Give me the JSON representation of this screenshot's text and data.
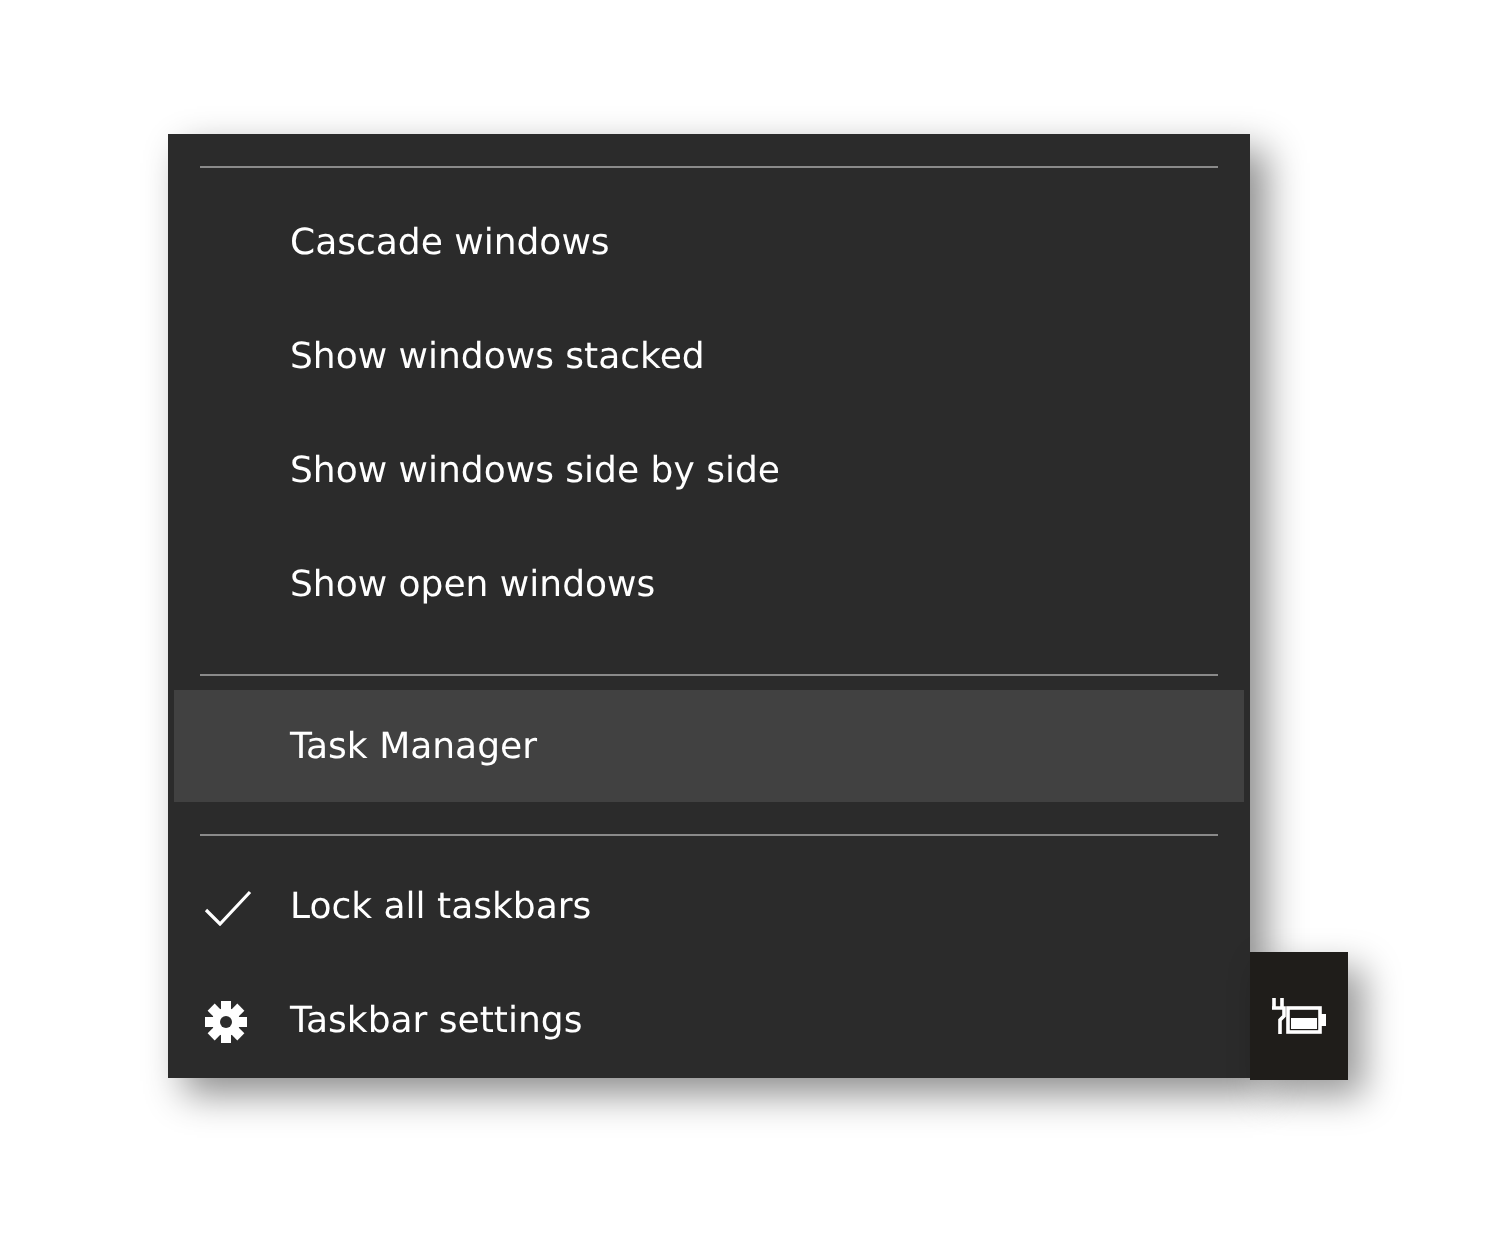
{
  "menu": {
    "items": [
      {
        "kind": "separator"
      },
      {
        "kind": "command",
        "label": "Cascade windows",
        "selected": false
      },
      {
        "kind": "command",
        "label": "Show windows stacked",
        "selected": false
      },
      {
        "kind": "command",
        "label": "Show windows side by side",
        "selected": false
      },
      {
        "kind": "command",
        "label": "Show open windows",
        "selected": false
      },
      {
        "kind": "separator"
      },
      {
        "kind": "command",
        "label": "Task Manager",
        "selected": true
      },
      {
        "kind": "separator"
      },
      {
        "kind": "check",
        "label": "Lock all taskbars",
        "checked": true,
        "selected": false
      },
      {
        "kind": "settings",
        "label": "Taskbar settings",
        "selected": false
      }
    ]
  },
  "tray": {
    "kind": "battery-charging"
  }
}
